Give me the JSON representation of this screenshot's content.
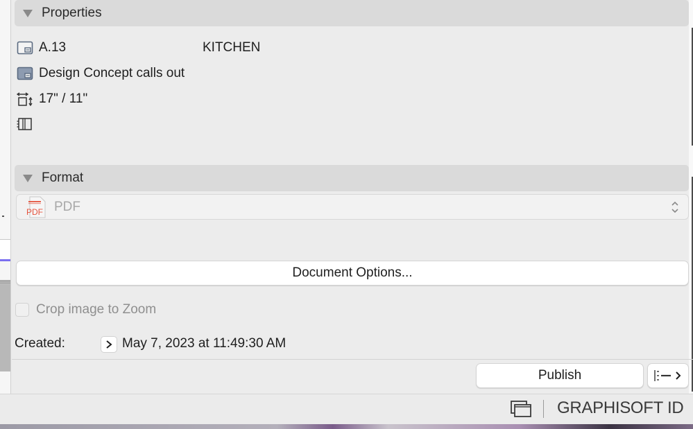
{
  "properties": {
    "header": "Properties",
    "rows": [
      {
        "icon": "layout-id-icon",
        "id": "A.13",
        "name": "KITCHEN"
      },
      {
        "icon": "layout-book-icon",
        "text": "Design Concept calls out"
      },
      {
        "icon": "paper-size-icon",
        "text": "17\" / 11\""
      },
      {
        "icon": "book-binding-icon",
        "text": ""
      }
    ]
  },
  "format": {
    "header": "Format",
    "selected": "PDF",
    "selected_icon": "pdf-file-icon"
  },
  "document_options_label": "Document Options...",
  "crop": {
    "label": "Crop image to Zoom",
    "checked": false,
    "enabled": false
  },
  "created": {
    "label": "Created:",
    "value": "May 7, 2023 at 11:49:30 AM"
  },
  "actions": {
    "publish_label": "Publish",
    "publish_options_icon": "publish-options-icon"
  },
  "status_bar": {
    "brand": "GRAPHISOFT ID",
    "windows_icon": "windows-icon"
  },
  "colors": {
    "accent": "#7b6ff0",
    "header_bg": "#dadada",
    "panel_bg": "#ececec",
    "pdf_red": "#e5533d"
  }
}
